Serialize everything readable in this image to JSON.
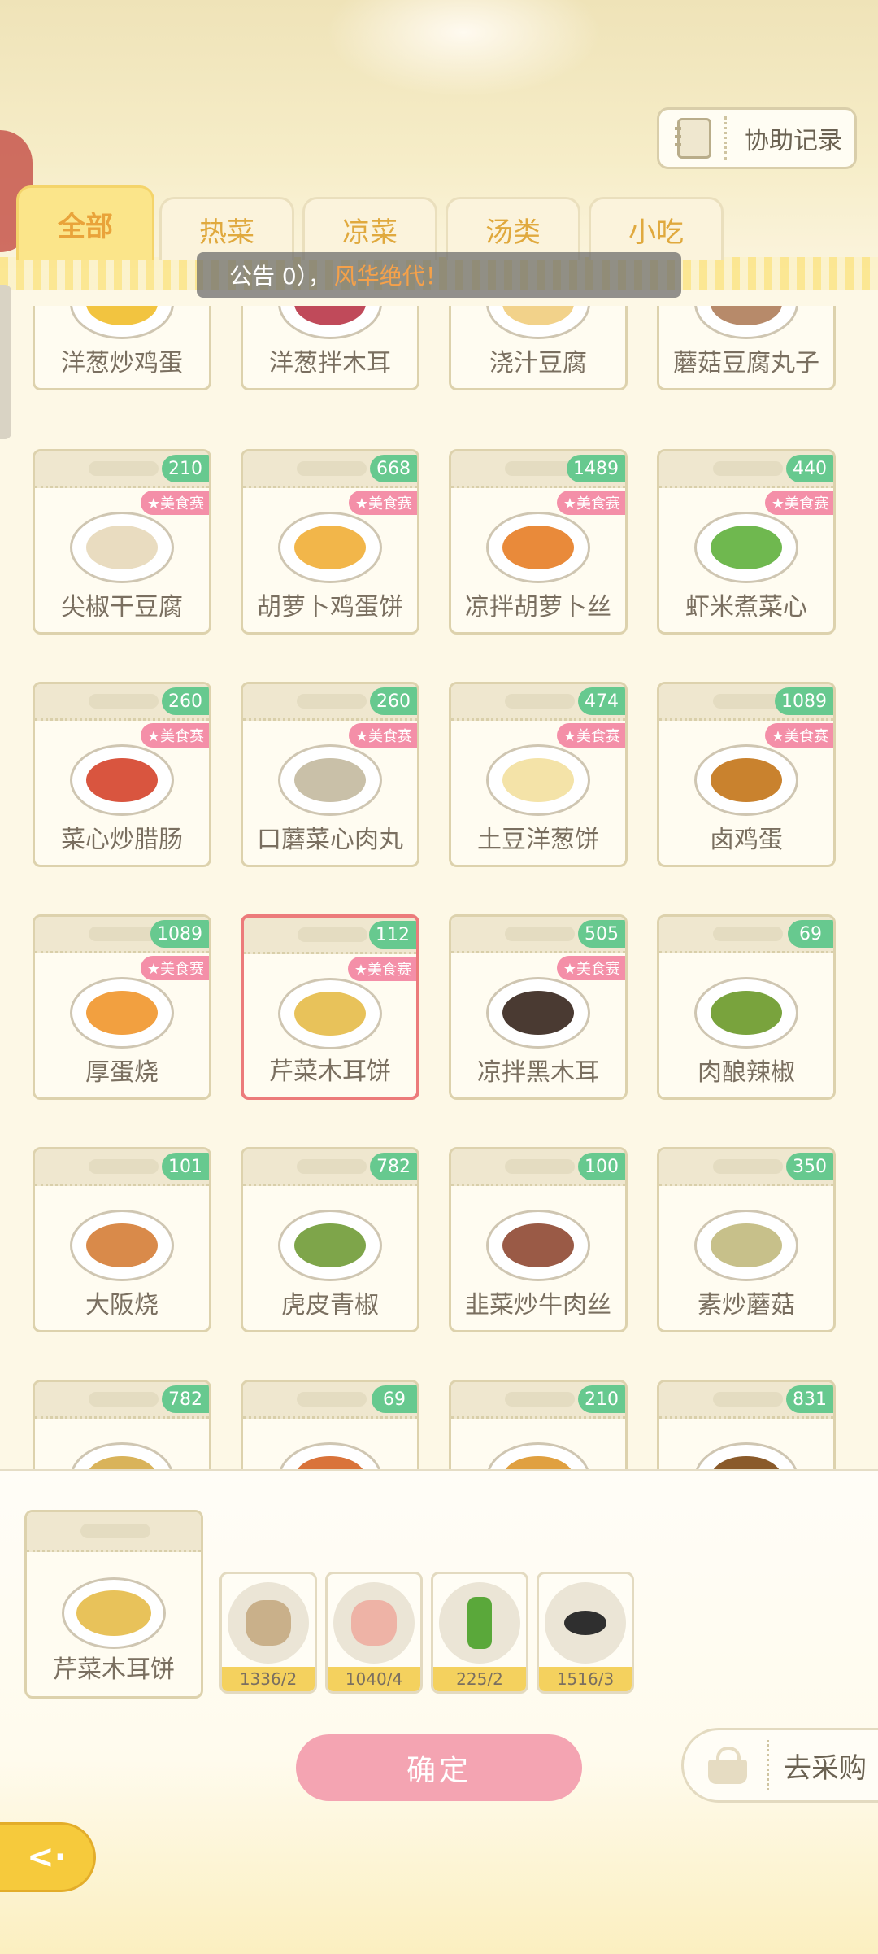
{
  "header": {
    "assist_record_label": "协助记录",
    "tabs": [
      {
        "label": "全部",
        "active": true
      },
      {
        "label": "热菜",
        "active": false
      },
      {
        "label": "凉菜",
        "active": false
      },
      {
        "label": "汤类",
        "active": false
      },
      {
        "label": "小吃",
        "active": false
      }
    ],
    "notice_prefix": "公告  0），",
    "notice_highlight": "风华绝代！"
  },
  "competition_badge": "★美食赛",
  "recipes_partial_top": [
    {
      "name": "洋葱炒鸡蛋"
    },
    {
      "name": "洋葱拌木耳"
    },
    {
      "name": "浇汁豆腐"
    },
    {
      "name": "蘑菇豆腐丸子"
    }
  ],
  "recipes": [
    {
      "name": "尖椒干豆腐",
      "count": "210",
      "badge": true,
      "color": "#e9dcc0"
    },
    {
      "name": "胡萝卜鸡蛋饼",
      "count": "668",
      "badge": true,
      "color": "#f2b64a"
    },
    {
      "name": "凉拌胡萝卜丝",
      "count": "1489",
      "badge": true,
      "color": "#e98a3a"
    },
    {
      "name": "虾米煮菜心",
      "count": "440",
      "badge": true,
      "color": "#6fb84f"
    },
    {
      "name": "菜心炒腊肠",
      "count": "260",
      "badge": true,
      "color": "#d9553f"
    },
    {
      "name": "口蘑菜心肉丸",
      "count": "260",
      "badge": true,
      "color": "#c9c0a8"
    },
    {
      "name": "土豆洋葱饼",
      "count": "474",
      "badge": true,
      "color": "#f4e3a8"
    },
    {
      "name": "卤鸡蛋",
      "count": "1089",
      "badge": true,
      "color": "#c9822e"
    },
    {
      "name": "厚蛋烧",
      "count": "1089",
      "badge": true,
      "color": "#f2a040"
    },
    {
      "name": "芹菜木耳饼",
      "count": "112",
      "badge": true,
      "color": "#e8c25a",
      "selected": true
    },
    {
      "name": "凉拌黑木耳",
      "count": "505",
      "badge": true,
      "color": "#4a3a32"
    },
    {
      "name": "肉酿辣椒",
      "count": "69",
      "badge": false,
      "color": "#79a33d"
    },
    {
      "name": "大阪烧",
      "count": "101",
      "badge": false,
      "color": "#d98a4a"
    },
    {
      "name": "虎皮青椒",
      "count": "782",
      "badge": false,
      "color": "#7ea54a"
    },
    {
      "name": "韭菜炒牛肉丝",
      "count": "100",
      "badge": false,
      "color": "#9a5a46"
    },
    {
      "name": "素炒蘑菇",
      "count": "350",
      "badge": false,
      "color": "#c7c08a"
    }
  ],
  "recipes_partial_bottom": [
    {
      "count": "782"
    },
    {
      "count": "69"
    },
    {
      "count": "210"
    },
    {
      "count": "831"
    }
  ],
  "selected": {
    "name": "芹菜木耳饼",
    "ingredients": [
      {
        "icon": "flour-sack-icon",
        "qty": "1336/2",
        "color": "#c9b08a"
      },
      {
        "icon": "meat-slices-icon",
        "qty": "1040/4",
        "color": "#eeb3a6"
      },
      {
        "icon": "celery-icon",
        "qty": "225/2",
        "color": "#5aa83a"
      },
      {
        "icon": "wood-ear-fungus-icon",
        "qty": "1516/3",
        "color": "#2f2f2f"
      }
    ]
  },
  "actions": {
    "confirm_label": "确定",
    "shop_label": "去采购"
  }
}
